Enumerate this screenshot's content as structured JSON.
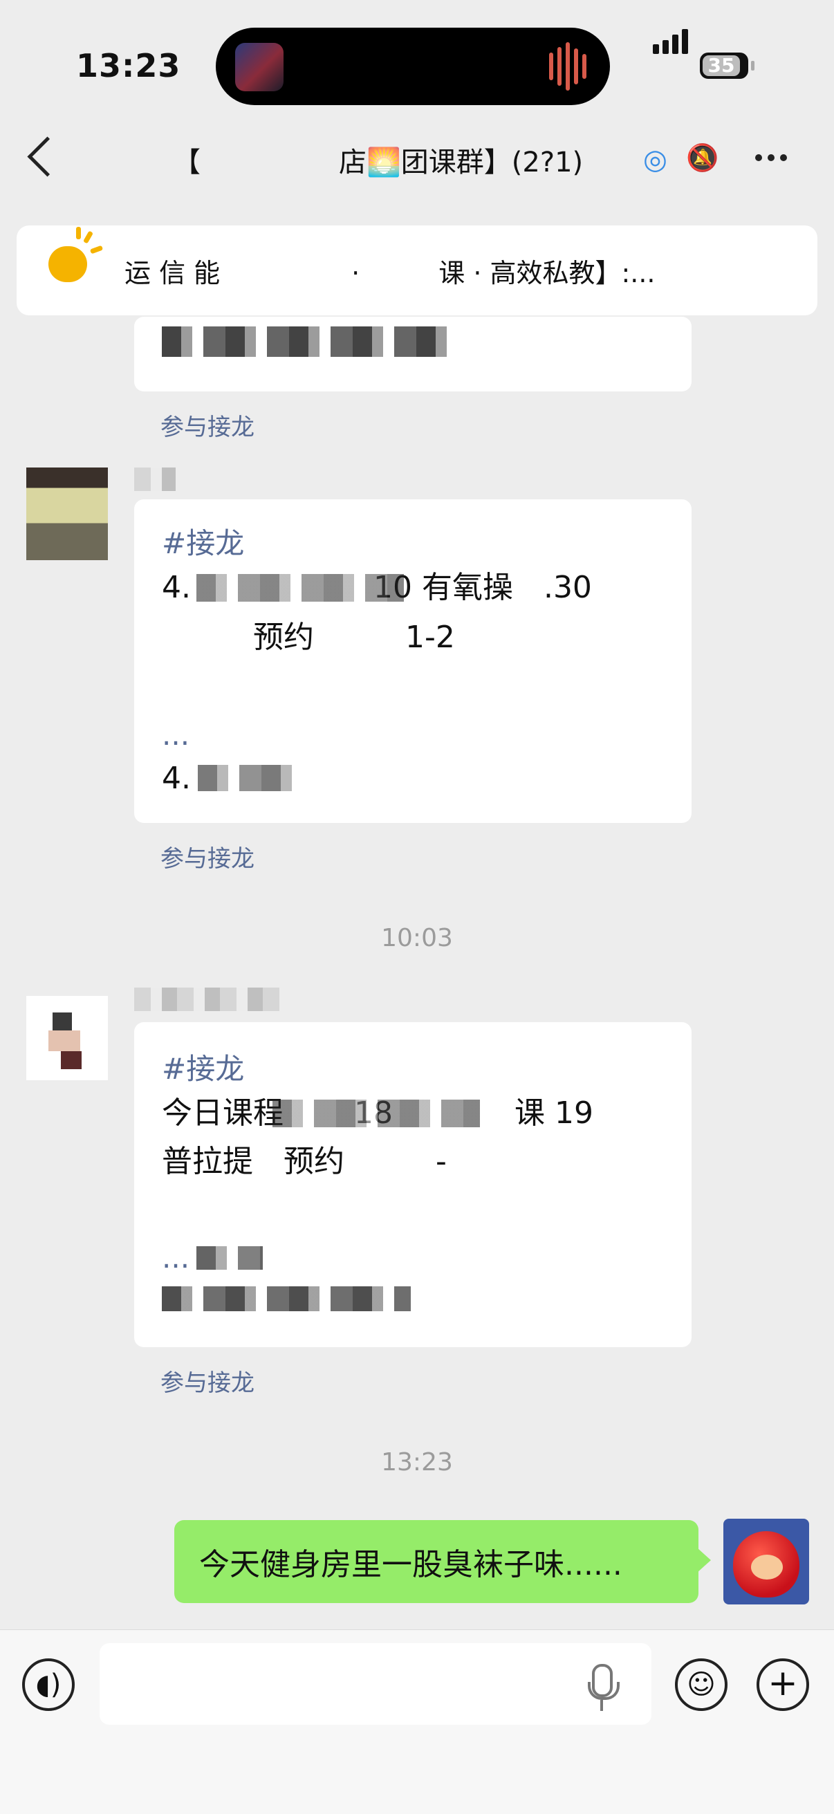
{
  "status_bar": {
    "time": "13:23",
    "battery": "35"
  },
  "nav": {
    "title": "【     店🌅团课群】(2?1)"
  },
  "pinned_notice": {
    "text": "运 信 能     ·   课 · 高效私教】:..."
  },
  "messages": [
    {
      "type": "solitaire-partial",
      "join_label": "参与接龙"
    },
    {
      "type": "solitaire",
      "tag": "#接龙",
      "lines": [
        "4.      10 有氧操 .30",
        "   预约   1-2"
      ],
      "more": "...",
      "entry": "4.",
      "join_label": "参与接龙"
    },
    {
      "type": "timestamp",
      "text": "10:03"
    },
    {
      "type": "solitaire",
      "tag": "#接龙",
      "lines": [
        "今日课程   18    课 19",
        "普拉提 预约   -"
      ],
      "more": "...",
      "entry": "",
      "join_label": "参与接龙"
    },
    {
      "type": "timestamp",
      "text": "13:23"
    },
    {
      "type": "own",
      "text": "今天健身房里一股臭袜子味......"
    }
  ],
  "input": {
    "placeholder": ""
  },
  "colors": {
    "accent_link": "#576b95",
    "own_bubble": "#95ec69",
    "background": "#ededed",
    "notice_icon": "#f5b300"
  },
  "icons": [
    "back-chevron-icon",
    "chat-bubble-icon",
    "mute-bell-icon",
    "more-dots-icon",
    "announcement-icon",
    "voice-icon",
    "mic-icon",
    "emoji-icon",
    "plus-icon"
  ]
}
